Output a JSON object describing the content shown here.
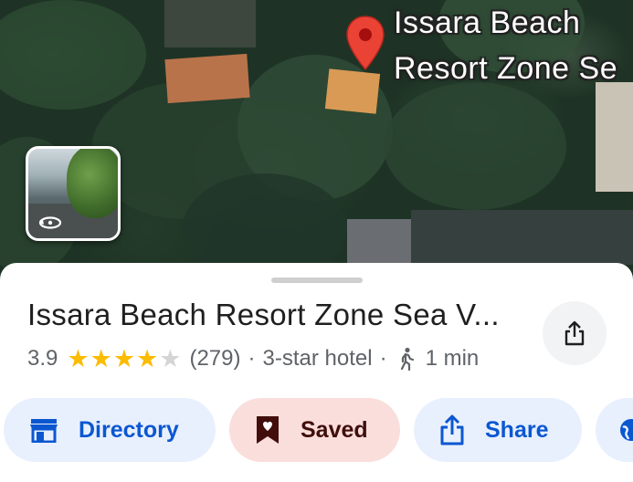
{
  "map": {
    "place_label_line1": "Issara Beach",
    "place_label_line2": "Resort Zone Se",
    "pin_icon": "location-pin-icon",
    "street_view_icon": "street-view-rotate-icon"
  },
  "place": {
    "title": "Issara Beach Resort Zone Sea V...",
    "rating": "3.9",
    "stars": 3.9,
    "review_count": "(279)",
    "separator": "·",
    "category": "3-star hotel",
    "walk_time": "1 min",
    "walk_icon": "walking-person-icon",
    "share_icon": "share-icon"
  },
  "actions": [
    {
      "label": "Directory",
      "icon": "storefront-icon"
    },
    {
      "label": "Saved",
      "icon": "bookmark-heart-icon"
    },
    {
      "label": "Share",
      "icon": "share-icon"
    },
    {
      "label": "",
      "icon": "globe-icon"
    }
  ],
  "colors": {
    "accent_blue": "#0b57d0",
    "chip_blue_bg": "#e8f0fe",
    "chip_saved_bg": "#f9dedc",
    "saved_text": "#410e0b",
    "pin_red": "#ea4335",
    "star_yellow": "#fbbc04"
  }
}
